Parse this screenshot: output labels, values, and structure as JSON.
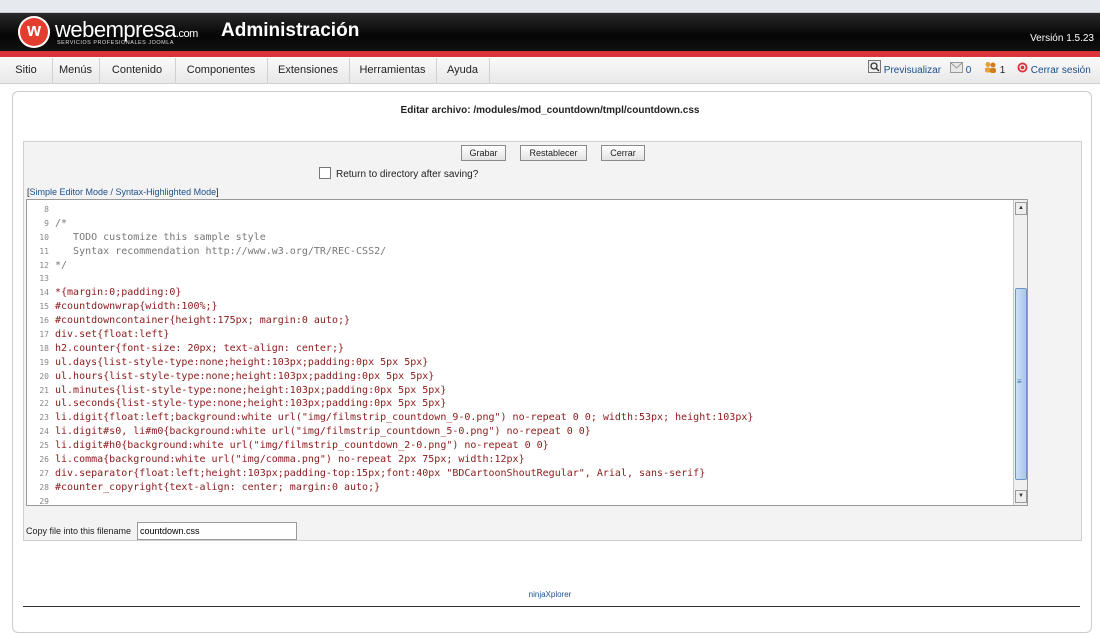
{
  "header": {
    "brand_name": "webempresa",
    "brand_domain": ".com",
    "brand_tagline": "SERVICIOS PROFESIONALES JOOMLA",
    "logo_letter": "w",
    "title": "Administración",
    "version": "Versión 1.5.23"
  },
  "menu": {
    "items": [
      "Sitio",
      "Menús",
      "Contenido",
      "Componentes",
      "Extensiones",
      "Herramientas",
      "Ayuda"
    ],
    "preview_label": "Previsualizar",
    "messages_count": "0",
    "users_count": "1",
    "logout_label": "Cerrar sesión"
  },
  "page": {
    "edit_file_title": "Editar archivo: /modules/mod_countdown/tmpl/countdown.css",
    "save_button": "Grabar",
    "reset_button": "Restablecer",
    "close_button": "Cerrar",
    "return_checkbox_label": "Return to directory after saving?",
    "mode_link": "Simple Editor Mode / Syntax-Highlighted Mode",
    "copy_label": "Copy file into this filename",
    "copy_value": "countdown.css",
    "footer_link": "ninjaXplorer"
  },
  "editor": {
    "lines": [
      {
        "n": "8",
        "t": ""
      },
      {
        "n": "9",
        "t": "/*"
      },
      {
        "n": "10",
        "t": "   TODO customize this sample style"
      },
      {
        "n": "11",
        "t": "   Syntax recommendation http://www.w3.org/TR/REC-CSS2/"
      },
      {
        "n": "12",
        "t": "*/"
      },
      {
        "n": "13",
        "t": ""
      },
      {
        "n": "14",
        "t": "*{margin:0;padding:0}"
      },
      {
        "n": "15",
        "t": "#countdownwrap{width:100%;}"
      },
      {
        "n": "16",
        "t": "#countdowncontainer{height:175px; margin:0 auto;}"
      },
      {
        "n": "17",
        "t": "div.set{float:left}"
      },
      {
        "n": "18",
        "t": "h2.counter{font-size: 20px; text-align: center;}"
      },
      {
        "n": "19",
        "t": "ul.days{list-style-type:none;height:103px;padding:0px 5px 5px}"
      },
      {
        "n": "20",
        "t": "ul.hours{list-style-type:none;height:103px;padding:0px 5px 5px}"
      },
      {
        "n": "21",
        "t": "ul.minutes{list-style-type:none;height:103px;padding:0px 5px 5px}"
      },
      {
        "n": "22",
        "t": "ul.seconds{list-style-type:none;height:103px;padding:0px 5px 5px}"
      },
      {
        "n": "23",
        "t": "li.digit{float:left;background:white url(\"img/filmstrip_countdown_9-0.png\") no-repeat 0 0; width:53px; height:103px}"
      },
      {
        "n": "24",
        "t": "li.digit#s0, li#m0{background:white url(\"img/filmstrip_countdown_5-0.png\") no-repeat 0 0}"
      },
      {
        "n": "25",
        "t": "li.digit#h0{background:white url(\"img/filmstrip_countdown_2-0.png\") no-repeat 0 0}"
      },
      {
        "n": "26",
        "t": "li.comma{background:white url(\"img/comma.png\") no-repeat 2px 75px; width:12px}"
      },
      {
        "n": "27",
        "t": "div.separator{float:left;height:103px;padding-top:15px;font:40px \"BDCartoonShoutRegular\", Arial, sans-serif}"
      },
      {
        "n": "28",
        "t": "#counter_copyright{text-align: center; margin:0 auto;}"
      },
      {
        "n": "29",
        "t": ""
      }
    ]
  },
  "icons": {
    "preview": "magnifier-icon",
    "messages": "envelope-icon",
    "users": "users-icon",
    "logout": "power-icon"
  },
  "colors": {
    "accent_red": "#d9343a",
    "header_bg": "#000000",
    "link_blue": "#1a4f8b"
  }
}
